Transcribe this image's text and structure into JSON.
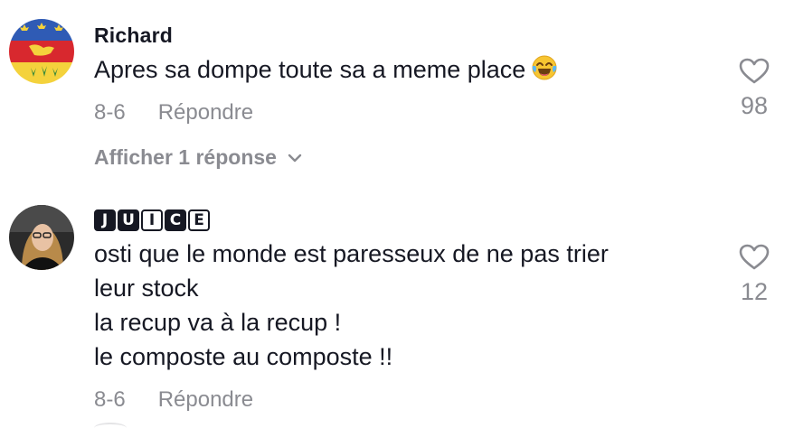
{
  "comments": [
    {
      "username": "Richard",
      "text": "Apres sa dompe toute sa a meme place",
      "emoji_icon": "face-with-tears-of-joy-icon",
      "date": "8-6",
      "reply_label": "Répondre",
      "likes": "98",
      "show_replies_label": "Afficher 1 réponse"
    },
    {
      "username_badges": [
        "J",
        "U",
        "I",
        "C",
        "E"
      ],
      "text_lines": [
        "osti que le monde est paresseux de ne pas trier",
        "leur stock",
        "la recup va à la recup !",
        "le composte au composte !!"
      ],
      "date": "8-6",
      "reply_label": "Répondre",
      "likes": "12"
    }
  ],
  "colors": {
    "text": "#161823",
    "muted": "#8a8b91"
  }
}
